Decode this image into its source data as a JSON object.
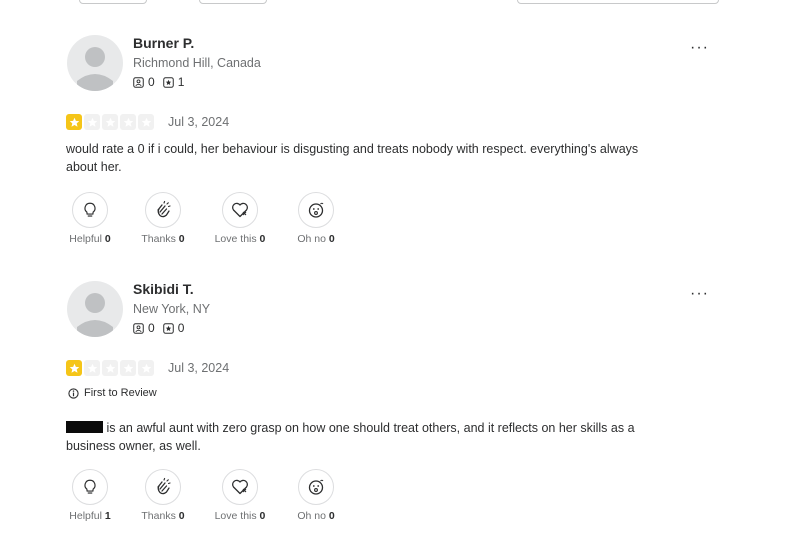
{
  "reviews": [
    {
      "name": "Burner P.",
      "location": "Richmond Hill, Canada",
      "friends": "0",
      "reviews_count": "1",
      "rating": 1,
      "date": "Jul 3, 2024",
      "badge": "",
      "text": "would rate a 0 if i could, her behaviour is disgusting and treats nobody with respect. everything's always about her.",
      "reactions": [
        {
          "label": "Helpful",
          "count": "0"
        },
        {
          "label": "Thanks",
          "count": "0"
        },
        {
          "label": "Love this",
          "count": "0"
        },
        {
          "label": "Oh no",
          "count": "0"
        }
      ]
    },
    {
      "name": "Skibidi T.",
      "location": "New York, NY",
      "friends": "0",
      "reviews_count": "0",
      "rating": 1,
      "date": "Jul 3, 2024",
      "badge": "First to Review",
      "text": " is an awful aunt with zero grasp on how one should treat others, and it reflects on her skills as a business owner, as well.",
      "reactions": [
        {
          "label": "Helpful",
          "count": "1"
        },
        {
          "label": "Thanks",
          "count": "0"
        },
        {
          "label": "Love this",
          "count": "0"
        },
        {
          "label": "Oh no",
          "count": "0"
        }
      ]
    }
  ],
  "more_label": "···",
  "colors": {
    "star": "#f5c518",
    "star_empty": "#f1f1f1",
    "muted": "#6e7072",
    "text": "#2d2e2f"
  },
  "icons": {
    "friends": "friends-icon",
    "reviews": "reviews-icon",
    "helpful": "lightbulb-icon",
    "thanks": "clapping-hands-icon",
    "love": "heart-icon",
    "ohno": "surprised-face-icon",
    "badge": "info-circle-icon",
    "more": "more-options-icon"
  }
}
